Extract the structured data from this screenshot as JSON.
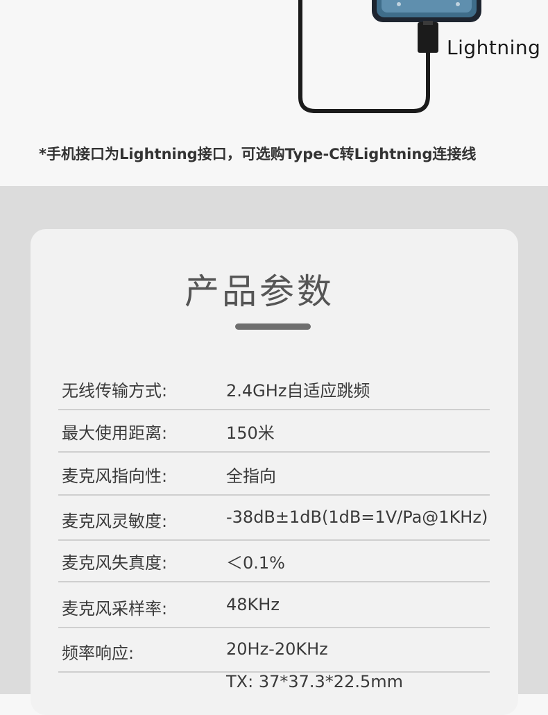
{
  "connector": {
    "label": "Lightning"
  },
  "note": "*手机接口为Lightning接口，可选购Type-C转Lightning连接线",
  "params": {
    "title": "产品参数",
    "rows": [
      {
        "label": "无线传输方式:",
        "value": "2.4GHz自适应跳频"
      },
      {
        "label": "最大使用距离:",
        "value": "150米"
      },
      {
        "label": "麦克风指向性:",
        "value": "全指向"
      },
      {
        "label": "麦克风灵敏度:",
        "value": "-38dB±1dB(1dB=1V/Pa@1KHz)"
      },
      {
        "label": "麦克风失真度:",
        "value": "＜0.1%"
      },
      {
        "label": "麦克风采样率:",
        "value": "48KHz"
      },
      {
        "label": "频率响应:",
        "value": "20Hz-20KHz"
      },
      {
        "label": "",
        "value": "TX: 37*37.3*22.5mm"
      }
    ]
  },
  "colors": {
    "background_top": "#f7f7f7",
    "background_bottom": "#dcdcdc",
    "card": "#f2f2f2",
    "accent_bar": "#6e6e6e",
    "text": "#3a3a3a"
  }
}
